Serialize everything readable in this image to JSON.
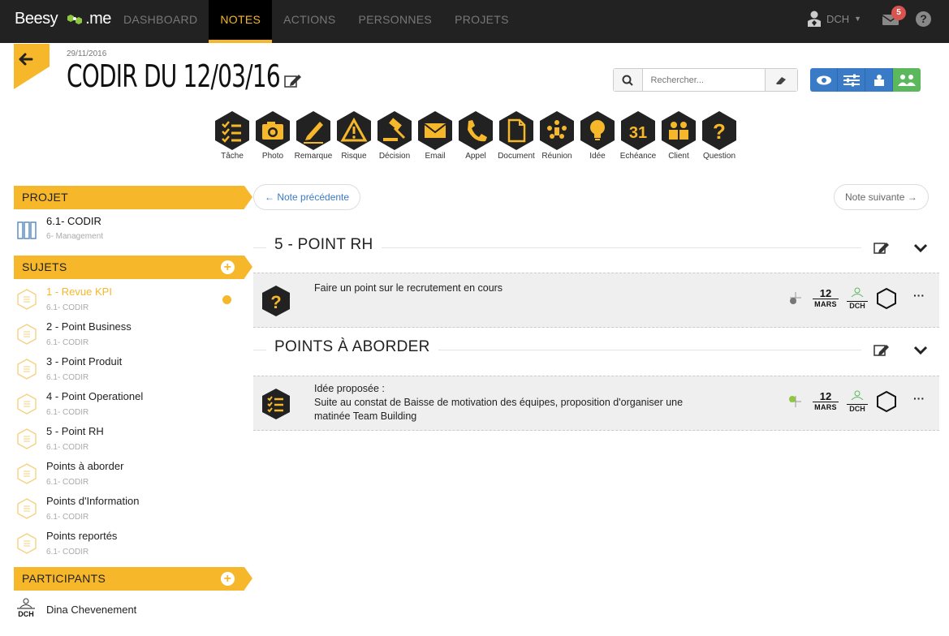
{
  "app": {
    "logo": "Beesy",
    "logo_suffix": ".me"
  },
  "nav": {
    "items": [
      "DASHBOARD",
      "NOTES",
      "ACTIONS",
      "PERSONNES",
      "PROJETS"
    ],
    "active": "NOTES"
  },
  "user": {
    "initials": "DCH",
    "mail_count": "5",
    "help": "?"
  },
  "meeting": {
    "date": "29/11/2016",
    "title": "CODIR DU 12/03/16"
  },
  "search": {
    "placeholder": "Rechercher..."
  },
  "note_types": [
    "Tâche",
    "Photo",
    "Remarque",
    "Risque",
    "Décision",
    "Email",
    "Appel",
    "Document",
    "Réunion",
    "Idée",
    "Echéance",
    "Client",
    "Question"
  ],
  "pager": {
    "prev": "← Note précédente",
    "next": "Note suivante →"
  },
  "sidebar": {
    "projet_header": "PROJET",
    "projet": {
      "name": "6.1- CODIR",
      "sub": "6- Management"
    },
    "sujets_header": "SUJETS",
    "sujets": [
      {
        "name": "1 - Revue KPI",
        "sub": "6.1- CODIR"
      },
      {
        "name": "2 - Point Business",
        "sub": "6.1- CODIR"
      },
      {
        "name": "3 - Point Produit",
        "sub": "6.1- CODIR"
      },
      {
        "name": "4 - Point Operationel",
        "sub": "6.1- CODIR"
      },
      {
        "name": "5 - Point RH",
        "sub": "6.1- CODIR"
      },
      {
        "name": "Points à aborder",
        "sub": "6.1- CODIR"
      },
      {
        "name": "Points d'Information",
        "sub": "6.1- CODIR"
      },
      {
        "name": "Points reportés",
        "sub": "6.1- CODIR"
      }
    ],
    "participants_header": "PARTICIPANTS",
    "participants": [
      {
        "initials": "DCH",
        "name": "Dina Chevenement"
      }
    ]
  },
  "sections": [
    {
      "title": "5 - POINT RH",
      "note": {
        "lines": [
          "Faire un point sur le recrutement en cours"
        ],
        "day": "12",
        "month": "MARS",
        "owner": "DCH",
        "type": "question-icon"
      }
    },
    {
      "title": "POINTS À ABORDER",
      "note": {
        "lines": [
          "Idée proposée :",
          "Suite au constat de Baisse de motivation des équipes, proposition d'organiser une",
          "matinée Team Building"
        ],
        "day": "12",
        "month": "MARS",
        "owner": "DCH",
        "type": "task-icon"
      }
    }
  ],
  "colors": {
    "accent": "#f6b72a",
    "topbar": "#222222",
    "blue": "#3a7bc8",
    "green": "#5cb85c"
  }
}
